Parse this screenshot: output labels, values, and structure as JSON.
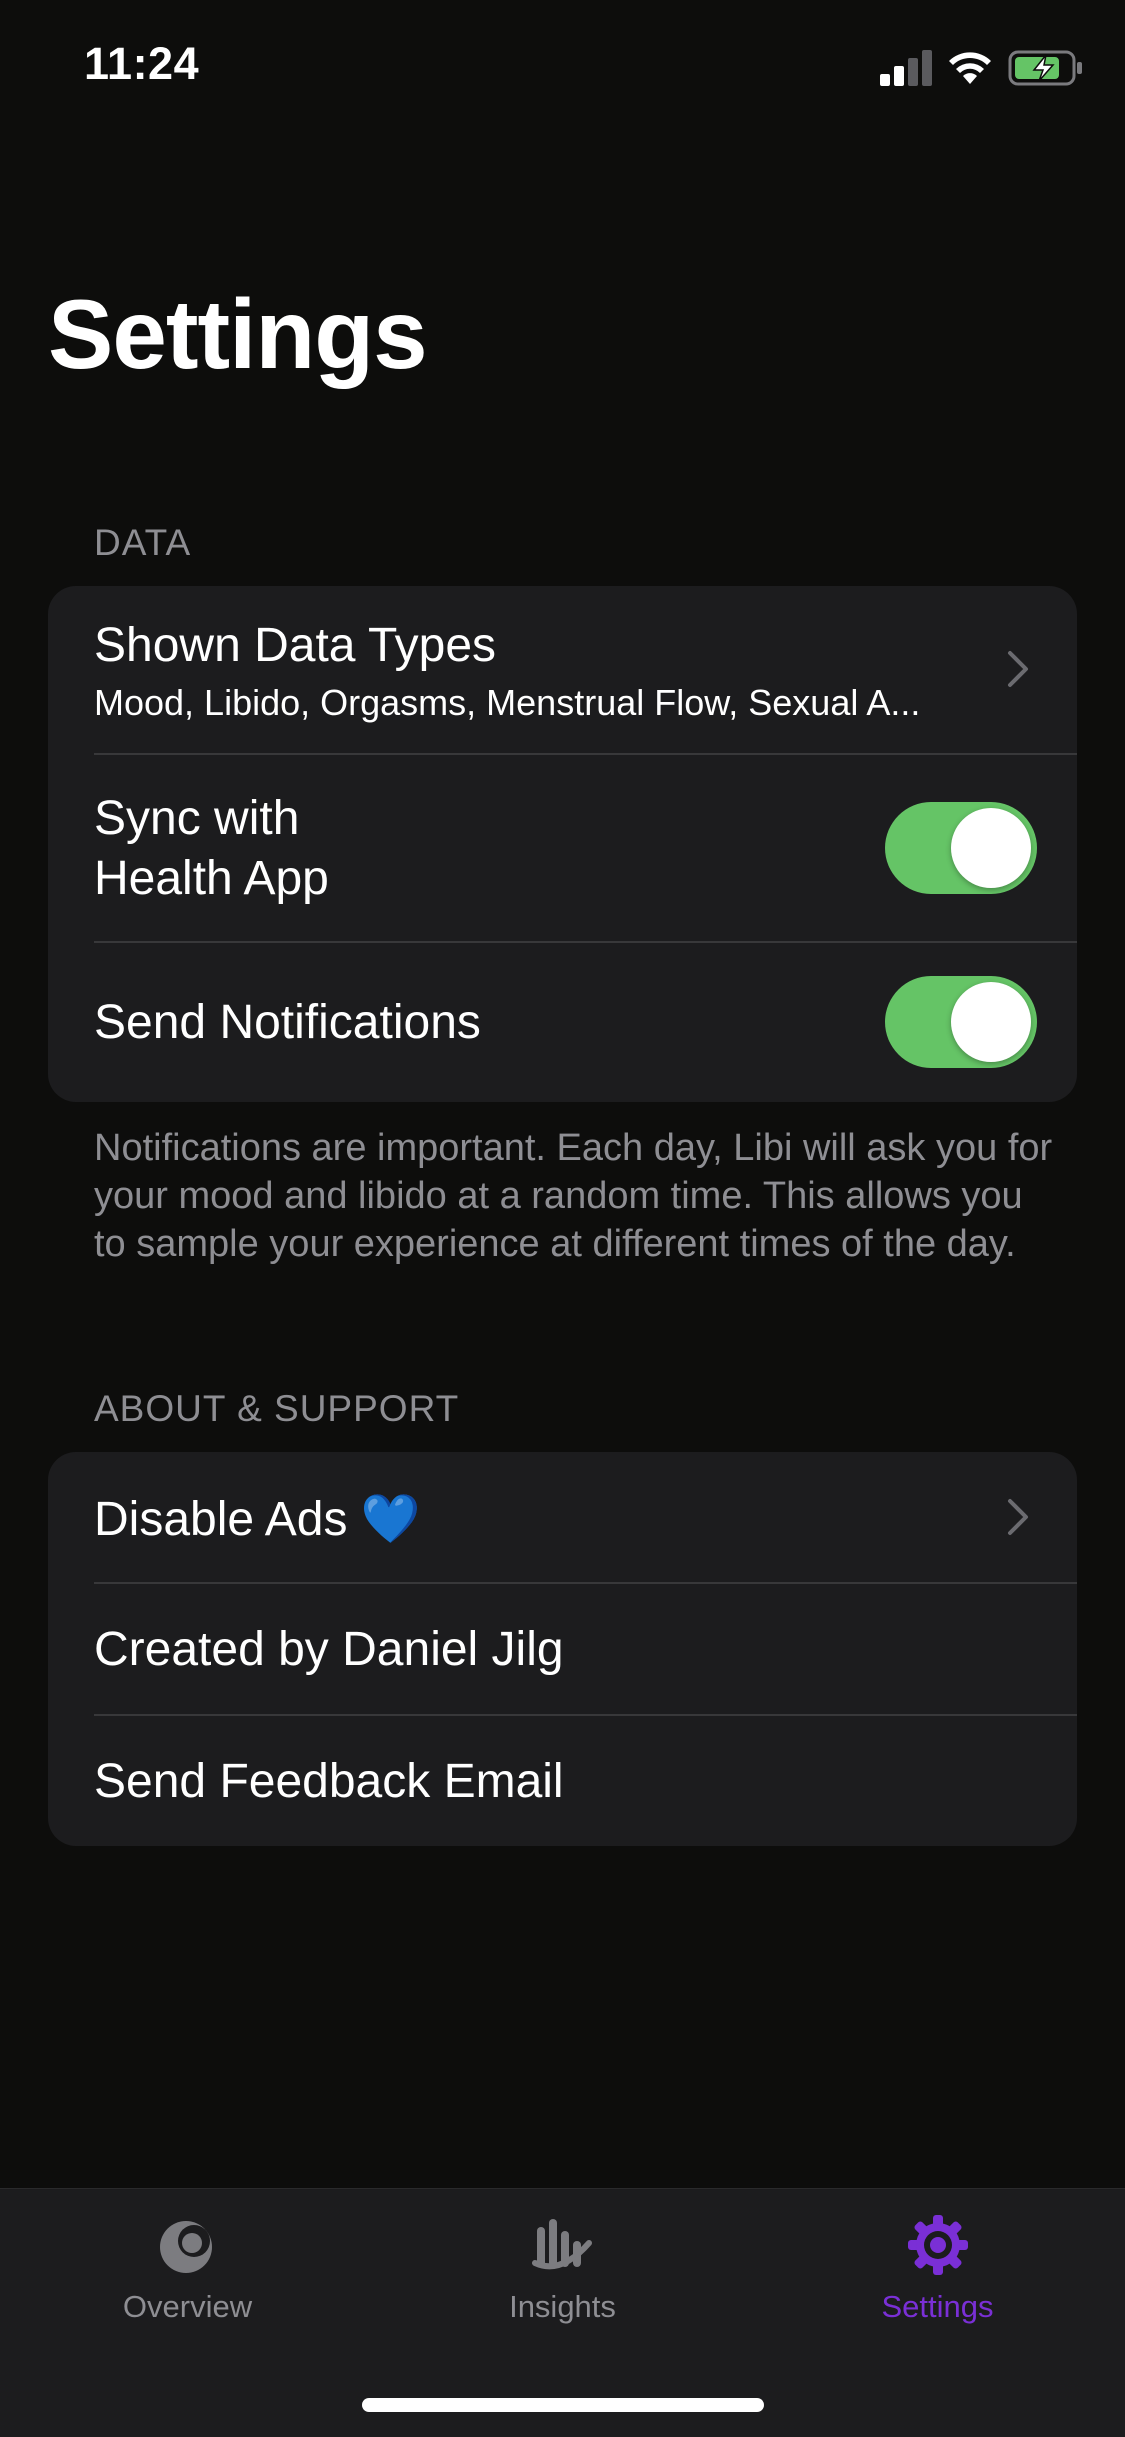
{
  "status_bar": {
    "time": "11:24"
  },
  "page_title": "Settings",
  "sections": {
    "data": {
      "header": "DATA",
      "shown_data_types": {
        "label": "Shown Data Types",
        "value": "Mood, Libido, Orgasms, Menstrual Flow, Sexual A..."
      },
      "sync_health": {
        "label_line1": "Sync with",
        "label_line2": "Health App",
        "enabled": true
      },
      "notifications": {
        "label": "Send Notifications",
        "enabled": true
      },
      "footer": "Notifications are important. Each day, Libi will ask you for your mood and libido at a random time. This allows you to sample your experience at different times of the day."
    },
    "about": {
      "header": "ABOUT & SUPPORT",
      "disable_ads": {
        "label": "Disable Ads",
        "emoji": "💙"
      },
      "created_by": {
        "label": "Created by Daniel Jilg"
      },
      "feedback": {
        "label": "Send Feedback Email"
      }
    }
  },
  "tab_bar": {
    "tabs": [
      {
        "label": "Overview",
        "icon": "overview-icon",
        "active": false
      },
      {
        "label": "Insights",
        "icon": "insights-icon",
        "active": false
      },
      {
        "label": "Settings",
        "icon": "gear-icon",
        "active": true
      }
    ],
    "active_color": "#7a2fd6",
    "inactive_color": "#8e8e93"
  },
  "colors": {
    "toggle_on": "#65c466",
    "background": "#0d0d0c",
    "group_bg": "#1c1c1e"
  }
}
